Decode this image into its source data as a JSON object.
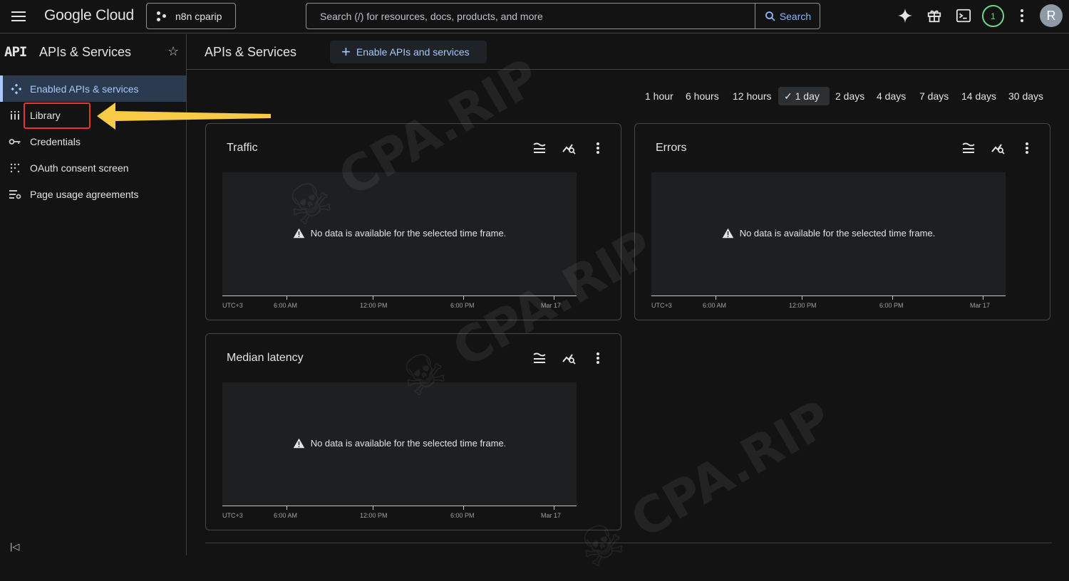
{
  "topbar": {
    "logo": "Google Cloud",
    "project": "n8n cparip",
    "search_placeholder": "Search (/) for resources, docs, products, and more",
    "search_button": "Search",
    "notification_count": "1",
    "avatar_initial": "R"
  },
  "sidebar": {
    "api_mark": "API",
    "title": "APIs & Services",
    "items": [
      {
        "label": "Enabled APIs & services",
        "icon": "diamond-icon"
      },
      {
        "label": "Library",
        "icon": "library-icon"
      },
      {
        "label": "Credentials",
        "icon": "key-icon"
      },
      {
        "label": "OAuth consent screen",
        "icon": "dots-grid-icon"
      },
      {
        "label": "Page usage agreements",
        "icon": "settings-list-icon"
      }
    ]
  },
  "main": {
    "title": "APIs & Services",
    "enable_button": "Enable APIs and services",
    "time_ranges": [
      "1 hour",
      "6 hours",
      "12 hours",
      "1 day",
      "2 days",
      "4 days",
      "7 days",
      "14 days",
      "30 days"
    ],
    "selected_range": "1 day",
    "no_data": "No data is available for the selected time frame.",
    "ticks": [
      "UTC+3",
      "6:00 AM",
      "12:00 PM",
      "6:00 PM",
      "Mar 17"
    ],
    "cards": [
      {
        "title": "Traffic"
      },
      {
        "title": "Errors"
      },
      {
        "title": "Median latency"
      }
    ]
  },
  "colors": {
    "accent": "#a8c7fa",
    "highlight_box": "#e8332e",
    "arrow": "#f7cb46",
    "badge": "#6dd58c"
  }
}
